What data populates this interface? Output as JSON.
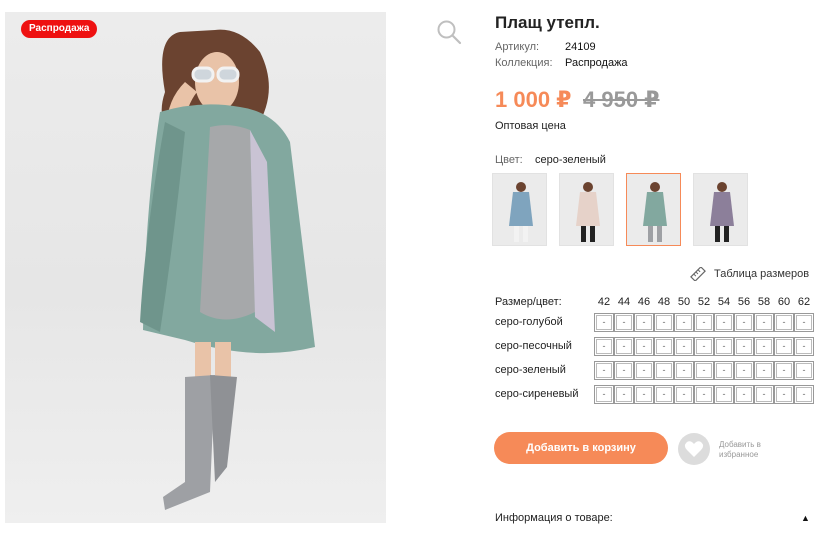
{
  "badge": "Распродажа",
  "product": {
    "title": "Плащ утепл.",
    "article_label": "Артикул:",
    "article_value": "24109",
    "collection_label": "Коллекция:",
    "collection_value": "Распродажа"
  },
  "price": {
    "current": "1 000 ₽",
    "old": "4 950 ₽",
    "note": "Оптовая цена",
    "accent_color": "#f68a58"
  },
  "color": {
    "label": "Цвет:",
    "value": "серо-зеленый",
    "swatches": [
      "серо-голубой",
      "серо-песочный",
      "серо-зеленый",
      "серо-сиреневый"
    ],
    "selected_index": 2
  },
  "size_chart_link": "Таблица размеров",
  "sizes": {
    "header_label": "Размер/цвет:",
    "sizes": [
      "42",
      "44",
      "46",
      "48",
      "50",
      "52",
      "54",
      "56",
      "58",
      "60",
      "62"
    ],
    "rows": [
      {
        "color": "серо-голубой",
        "cells": [
          "-",
          "-",
          "-",
          "-",
          "-",
          "-",
          "-",
          "-",
          "-",
          "-",
          "-"
        ]
      },
      {
        "color": "серо-песочный",
        "cells": [
          "-",
          "-",
          "-",
          "-",
          "-",
          "-",
          "-",
          "-",
          "-",
          "-",
          "-"
        ]
      },
      {
        "color": "серо-зеленый",
        "cells": [
          "-",
          "-",
          "-",
          "-",
          "-",
          "-",
          "-",
          "-",
          "-",
          "-",
          "-"
        ]
      },
      {
        "color": "серо-сиреневый",
        "cells": [
          "-",
          "-",
          "-",
          "-",
          "-",
          "-",
          "-",
          "-",
          "-",
          "-",
          "-"
        ]
      }
    ]
  },
  "actions": {
    "add_to_cart": "Добавить в корзину",
    "add_to_favorites": "Добавить в избранное"
  },
  "info": {
    "label": "Информация о товаре:",
    "toggle": "▲"
  }
}
